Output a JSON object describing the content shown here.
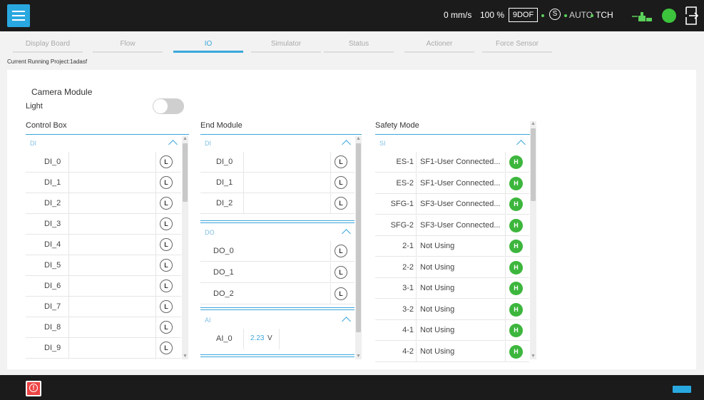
{
  "topbar": {
    "speed": "0 mm/s",
    "override": "100 %",
    "dof": "9DOF",
    "safety_symbol": "S",
    "mode": "AUTO",
    "coordinate": "TCH",
    "status_color": "#3cc43c",
    "accent": "#29a8e0",
    "icons": [
      "menu-icon",
      "safety-s-icon",
      "robot-connection-icon",
      "status-indicator-icon",
      "logout-icon"
    ]
  },
  "tabs": [
    "Display Board",
    "Flow",
    "IO",
    "Simulator",
    "Status",
    "Actioner",
    "Force Sensor"
  ],
  "active_tab": "IO",
  "project": "Current Running Project:1adasf",
  "camera": {
    "title": "Camera Module",
    "light_label": "Light",
    "light_on": false
  },
  "control_box": {
    "title": "Control Box",
    "group": "DI",
    "rows": [
      {
        "name": "DI_0",
        "level": "L"
      },
      {
        "name": "DI_1",
        "level": "L"
      },
      {
        "name": "DI_2",
        "level": "L"
      },
      {
        "name": "DI_3",
        "level": "L"
      },
      {
        "name": "DI_4",
        "level": "L"
      },
      {
        "name": "DI_5",
        "level": "L"
      },
      {
        "name": "DI_6",
        "level": "L"
      },
      {
        "name": "DI_7",
        "level": "L"
      },
      {
        "name": "DI_8",
        "level": "L"
      },
      {
        "name": "DI_9",
        "level": "L"
      }
    ]
  },
  "end_module": {
    "title": "End Module",
    "di_group": "DI",
    "di_rows": [
      {
        "name": "DI_0",
        "level": "L"
      },
      {
        "name": "DI_1",
        "level": "L"
      },
      {
        "name": "DI_2",
        "level": "L"
      }
    ],
    "do_group": "DO",
    "do_rows": [
      {
        "name": "DO_0",
        "level": "L"
      },
      {
        "name": "DO_1",
        "level": "L"
      },
      {
        "name": "DO_2",
        "level": "L"
      }
    ],
    "ai_group": "AI",
    "ai_rows": [
      {
        "name": "AI_0",
        "value": "2.23",
        "unit": "V"
      }
    ]
  },
  "safety_mode": {
    "title": "Safety Mode",
    "group": "SI",
    "rows": [
      {
        "id": "ES-1",
        "desc": "SF1-User Connected...",
        "level": "H"
      },
      {
        "id": "ES-2",
        "desc": "SF1-User Connected...",
        "level": "H"
      },
      {
        "id": "SFG-1",
        "desc": "SF3-User Connected...",
        "level": "H"
      },
      {
        "id": "SFG-2",
        "desc": "SF3-User Connected...",
        "level": "H"
      },
      {
        "id": "2-1",
        "desc": "Not Using",
        "level": "H"
      },
      {
        "id": "2-2",
        "desc": "Not Using",
        "level": "H"
      },
      {
        "id": "3-1",
        "desc": "Not Using",
        "level": "H"
      },
      {
        "id": "3-2",
        "desc": "Not Using",
        "level": "H"
      },
      {
        "id": "4-1",
        "desc": "Not Using",
        "level": "H"
      },
      {
        "id": "4-2",
        "desc": "Not Using",
        "level": "H"
      }
    ]
  },
  "bottombar": {
    "icons": [
      "alert-icon",
      "keyboard-icon"
    ]
  }
}
